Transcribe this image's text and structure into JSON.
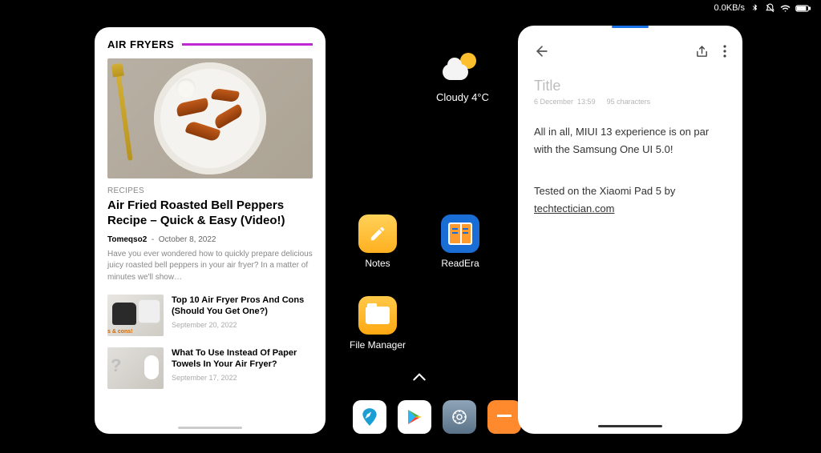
{
  "statusbar": {
    "net_speed": "0.0KB/s"
  },
  "weather": {
    "text": "Cloudy 4°C"
  },
  "apps": {
    "notes": "Notes",
    "readera": "ReadEra",
    "filemgr": "File Manager"
  },
  "blog": {
    "section": "AIR FRYERS",
    "category": "RECIPES",
    "title": "Air Fried Roasted Bell Peppers Recipe – Quick & Easy (Video!)",
    "author": "Tomeqso2",
    "date": "October 8, 2022",
    "excerpt": "Have you ever wondered how to quickly prepare delicious juicy roasted bell peppers in your air fryer? In a matter of minutes we'll show…",
    "items": [
      {
        "title": "Top 10 Air Fryer Pros And Cons (Should You Get One?)",
        "date": "September 20, 2022"
      },
      {
        "title": "What To Use Instead Of Paper Towels In Your Air Fryer?",
        "date": "September 17, 2022"
      }
    ]
  },
  "note": {
    "title_placeholder": "Title",
    "date": "6 December",
    "time": "13:59",
    "chars": "95 characters",
    "para1": "All in all, MIUI 13 experience is on par with the Samsung One UI 5.0!",
    "para2_prefix": "Tested on the Xiaomi Pad 5 by ",
    "link": "techtectician.com"
  }
}
